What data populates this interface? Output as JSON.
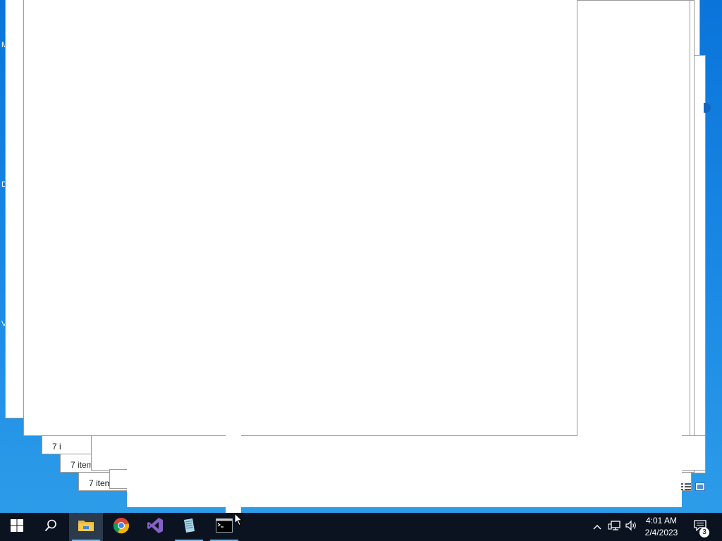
{
  "desktop": {
    "edge_letters": [
      "M",
      "D",
      "V"
    ]
  },
  "windows": {
    "status_1": "7 i",
    "status_2": "7 item",
    "status_3": "7 item"
  },
  "taskbar": {
    "start": "start-icon",
    "search": "search-icon",
    "apps": [
      {
        "name": "File Explorer",
        "icon": "folder-icon",
        "active": true
      },
      {
        "name": "Google Chrome",
        "icon": "chrome-icon",
        "active": false
      },
      {
        "name": "Visual Studio",
        "icon": "visual-studio-icon",
        "active": false
      },
      {
        "name": "Notepad",
        "icon": "notepad-icon",
        "active": false
      },
      {
        "name": "Command Prompt",
        "icon": "terminal-icon",
        "active": false
      }
    ],
    "clock_time": "4:01 AM",
    "clock_date": "2/4/2023",
    "notification_count": "3"
  },
  "colors": {
    "desktop_blue": "#0a74da",
    "taskbar": "#0b1320",
    "active_underline": "#76b9ed"
  }
}
